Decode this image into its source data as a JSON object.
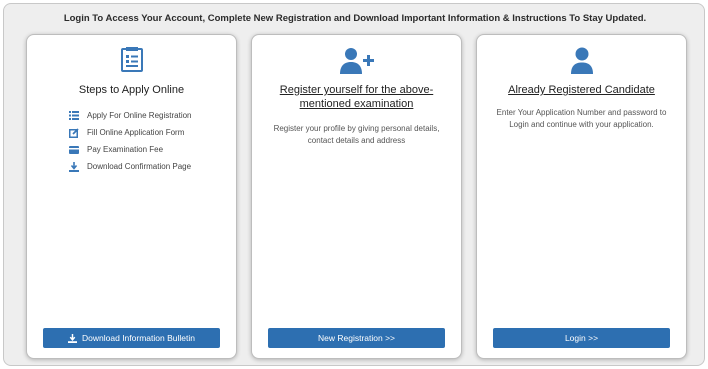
{
  "headline": "Login To Access Your Account, Complete New Registration and Download Important Information & Instructions To Stay Updated.",
  "colors": {
    "accent": "#2d6fb1",
    "icon": "#3a78b8",
    "panel": "#eeeeee"
  },
  "cards": [
    {
      "icon": "form-list-icon",
      "title": "Steps to Apply Online",
      "steps": [
        {
          "icon": "list-icon",
          "label": "Apply For Online Registration"
        },
        {
          "icon": "edit-icon",
          "label": "Fill Online Application Form"
        },
        {
          "icon": "credit-card-icon",
          "label": "Pay Examination Fee"
        },
        {
          "icon": "download-icon",
          "label": "Download Confirmation Page"
        }
      ],
      "button": {
        "icon": "download-icon",
        "label": "Download Information Bulletin"
      }
    },
    {
      "icon": "user-plus-icon",
      "title": "Register yourself for the above-mentioned examination",
      "description": "Register your profile by giving personal details, contact details and address",
      "button": {
        "label": "New Registration >>"
      }
    },
    {
      "icon": "user-icon",
      "title": "Already Registered Candidate",
      "description": "Enter Your Application Number and password to Login and continue with your application.",
      "button": {
        "label": "Login >>"
      }
    }
  ]
}
